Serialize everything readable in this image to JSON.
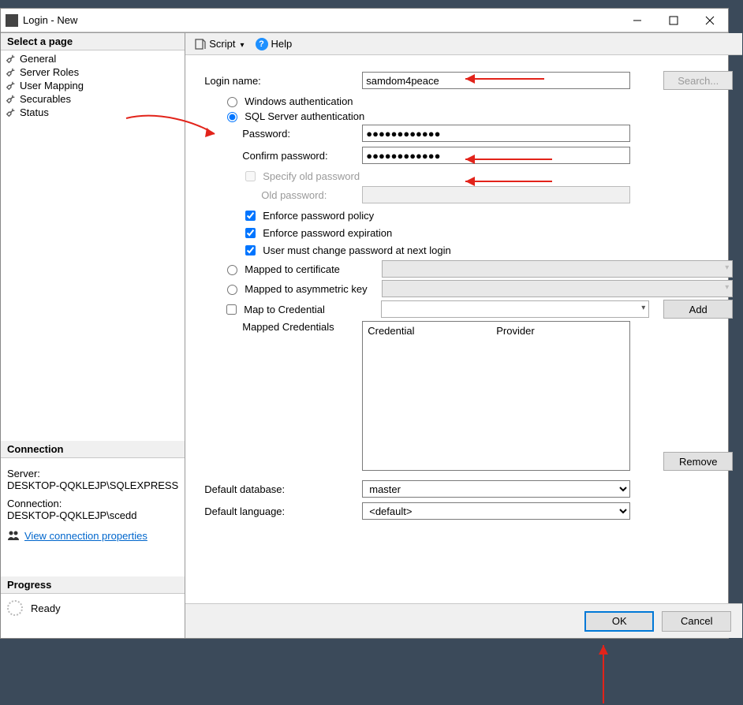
{
  "window": {
    "title": "Login - New"
  },
  "toolbar": {
    "script": "Script",
    "help": "Help"
  },
  "sidebar": {
    "header": "Select a page",
    "items": [
      {
        "label": "General"
      },
      {
        "label": "Server Roles"
      },
      {
        "label": "User Mapping"
      },
      {
        "label": "Securables"
      },
      {
        "label": "Status"
      }
    ]
  },
  "connection": {
    "header": "Connection",
    "server_label": "Server:",
    "server_value": "DESKTOP-QQKLEJP\\SQLEXPRESS",
    "conn_label": "Connection:",
    "conn_value": "DESKTOP-QQKLEJP\\scedd",
    "link": "View connection properties"
  },
  "progress": {
    "header": "Progress",
    "state": "Ready"
  },
  "form": {
    "login_name_label": "Login name:",
    "login_name_value": "samdom4peace",
    "search_btn": "Search...",
    "windows_auth": "Windows authentication",
    "sql_auth": "SQL Server authentication",
    "password_label": "Password:",
    "password_value": "●●●●●●●●●●●●",
    "confirm_label": "Confirm password:",
    "confirm_value": "●●●●●●●●●●●●",
    "specify_old": "Specify old password",
    "old_pw_label": "Old password:",
    "enforce_policy": "Enforce password policy",
    "enforce_expiration": "Enforce password expiration",
    "must_change": "User must change password at next login",
    "mapped_cert": "Mapped to certificate",
    "mapped_asym": "Mapped to asymmetric key",
    "map_to_cred": "Map to Credential",
    "add_btn": "Add",
    "mapped_creds_label": "Mapped Credentials",
    "col_credential": "Credential",
    "col_provider": "Provider",
    "remove_btn": "Remove",
    "default_db_label": "Default database:",
    "default_db_value": "master",
    "default_lang_label": "Default language:",
    "default_lang_value": "<default>"
  },
  "footer": {
    "ok": "OK",
    "cancel": "Cancel"
  }
}
